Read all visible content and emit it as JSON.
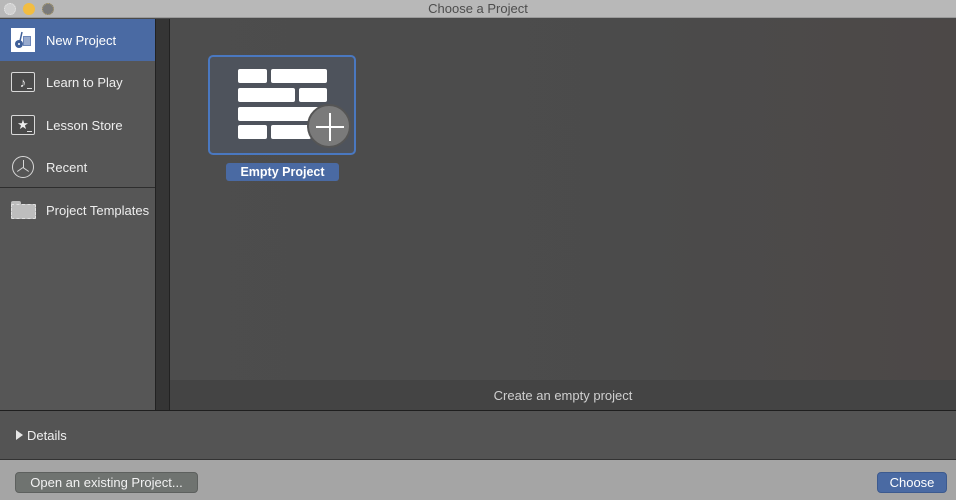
{
  "window": {
    "title": "Choose a Project"
  },
  "sidebar": {
    "items": [
      {
        "label": "New Project",
        "icon": "new-project-guitar-icon",
        "selected": true
      },
      {
        "label": "Learn to Play",
        "icon": "music-note-icon",
        "selected": false
      },
      {
        "label": "Lesson Store",
        "icon": "star-icon",
        "selected": false
      },
      {
        "label": "Recent",
        "icon": "clock-icon",
        "selected": false
      },
      {
        "label": "Project Templates",
        "icon": "folder-icon",
        "selected": false
      }
    ]
  },
  "main": {
    "projects": [
      {
        "label": "Empty Project",
        "icon": "empty-project-plus-icon",
        "selected": true
      }
    ],
    "description": "Create an empty project"
  },
  "details": {
    "label": "Details",
    "expanded": false
  },
  "footer": {
    "open_label": "Open an existing Project...",
    "choose_label": "Choose"
  },
  "colors": {
    "accent": "#4a6aa3",
    "background": "#4a4a4a"
  }
}
